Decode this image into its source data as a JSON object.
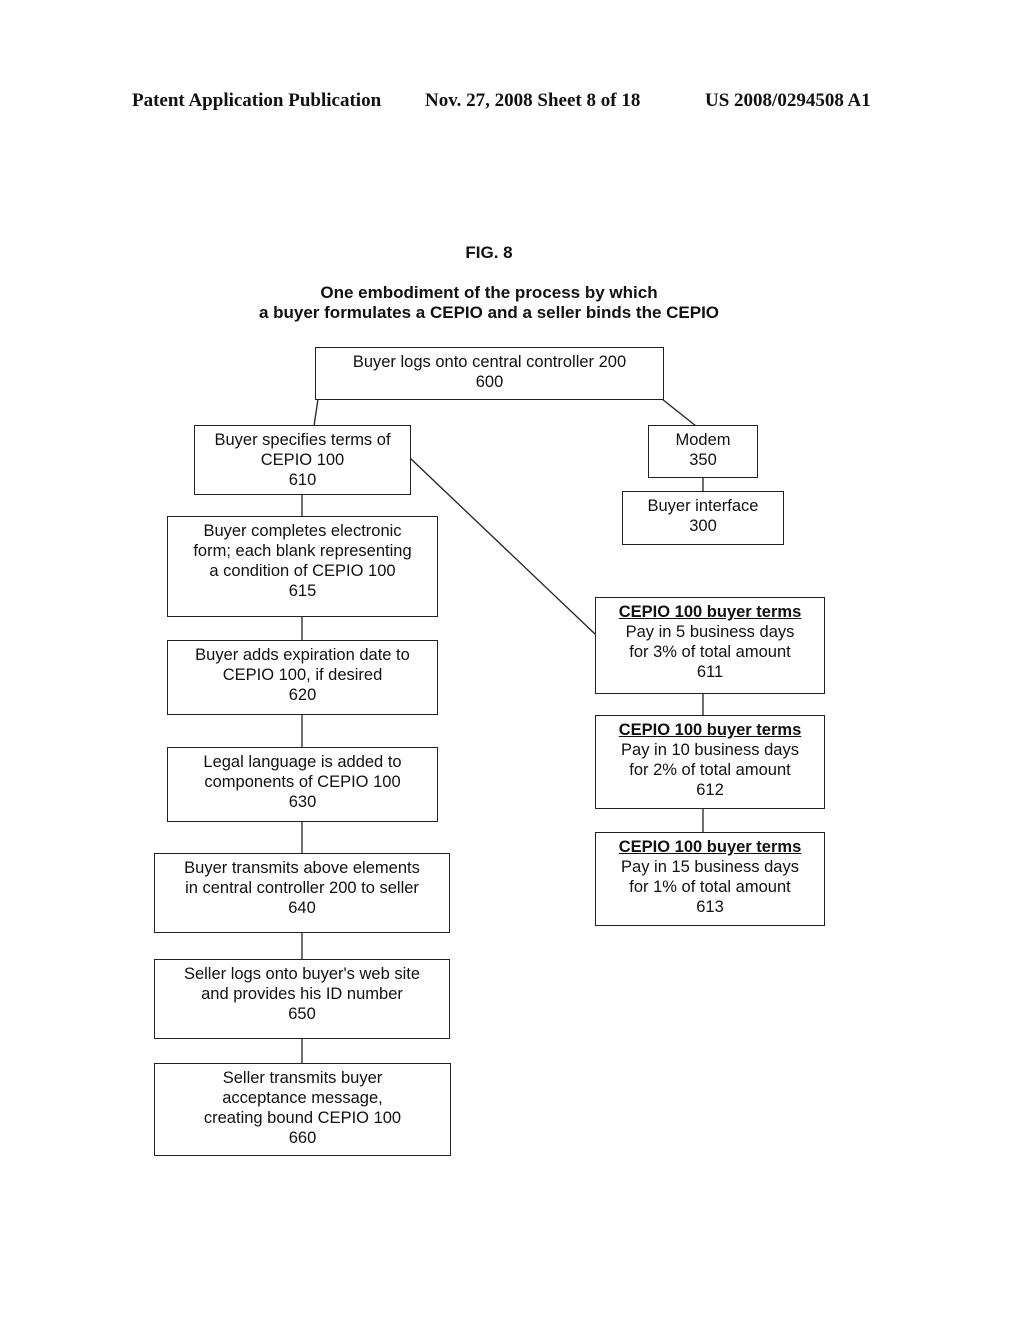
{
  "header": {
    "left": "Patent Application Publication",
    "middle": "Nov. 27, 2008  Sheet 8 of 18",
    "right": "US 2008/0294508 A1"
  },
  "figure": {
    "label": "FIG. 8",
    "subtitle_line1": "One embodiment of the process by which",
    "subtitle_line2": "a buyer formulates a CEPIO and a seller binds the CEPIO"
  },
  "nodes": {
    "n600": {
      "lines": [
        "Buyer logs onto central controller 200",
        "600"
      ]
    },
    "n610": {
      "lines": [
        "Buyer specifies terms of",
        "CEPIO 100",
        "610"
      ]
    },
    "n350": {
      "lines": [
        "Modem",
        "350"
      ]
    },
    "n300": {
      "lines": [
        "Buyer interface",
        "300"
      ]
    },
    "n615": {
      "lines": [
        "Buyer completes electronic",
        "form; each blank representing",
        "a condition of CEPIO 100",
        "615"
      ]
    },
    "n620": {
      "lines": [
        "Buyer adds expiration date to",
        "CEPIO 100, if desired",
        "620"
      ]
    },
    "n630": {
      "lines": [
        "Legal language is added to",
        "components of CEPIO 100",
        "630"
      ]
    },
    "n640": {
      "lines": [
        "Buyer transmits above elements",
        "in central controller 200 to seller",
        "640"
      ]
    },
    "n650": {
      "lines": [
        "Seller logs onto buyer's web site",
        "and provides his ID number",
        "650"
      ]
    },
    "n660": {
      "lines": [
        "Seller transmits buyer",
        "acceptance message,",
        "creating bound CEPIO 100",
        "660"
      ]
    },
    "n611": {
      "heading": "CEPIO 100 buyer terms",
      "lines": [
        "Pay in 5 business days",
        "for 3% of total amount",
        "611"
      ]
    },
    "n612": {
      "heading": "CEPIO 100 buyer terms",
      "lines": [
        "Pay in 10 business days",
        "for 2% of total amount",
        "612"
      ]
    },
    "n613": {
      "heading": "CEPIO 100 buyer terms",
      "lines": [
        "Pay in 15 business days",
        "for 1% of total amount",
        "613"
      ]
    }
  },
  "edges": [
    [
      "n600",
      "n610"
    ],
    [
      "n600",
      "n350"
    ],
    [
      "n350",
      "n300"
    ],
    [
      "n610",
      "n615"
    ],
    [
      "n610",
      "n611"
    ],
    [
      "n615",
      "n620"
    ],
    [
      "n620",
      "n630"
    ],
    [
      "n630",
      "n640"
    ],
    [
      "n640",
      "n650"
    ],
    [
      "n650",
      "n660"
    ],
    [
      "n611",
      "n612"
    ],
    [
      "n612",
      "n613"
    ]
  ]
}
